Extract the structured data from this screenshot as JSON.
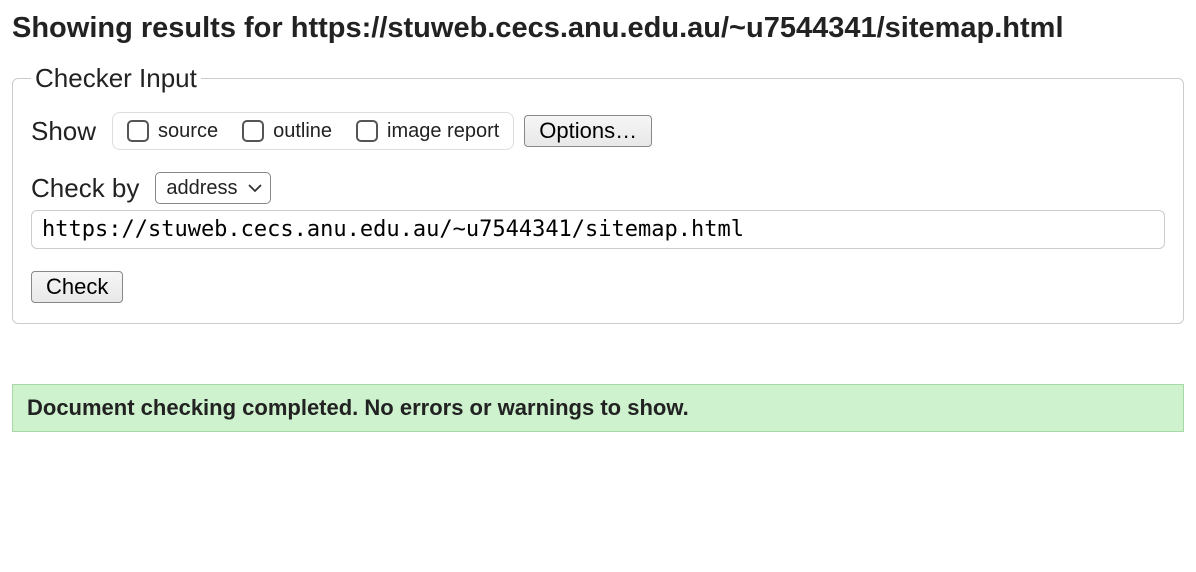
{
  "heading": {
    "prefix": "Showing results for ",
    "url": "https://stuweb.cecs.anu.edu.au/~u7544341/sitemap.html"
  },
  "fieldset": {
    "legend": "Checker Input",
    "show_label": "Show",
    "checkboxes": {
      "source": "source",
      "outline": "outline",
      "image_report": "image report"
    },
    "options_button": "Options…",
    "check_by_label": "Check by",
    "check_by_selected": "address",
    "url_value": "https://stuweb.cecs.anu.edu.au/~u7544341/sitemap.html",
    "check_button": "Check"
  },
  "result_message": "Document checking completed. No errors or warnings to show."
}
